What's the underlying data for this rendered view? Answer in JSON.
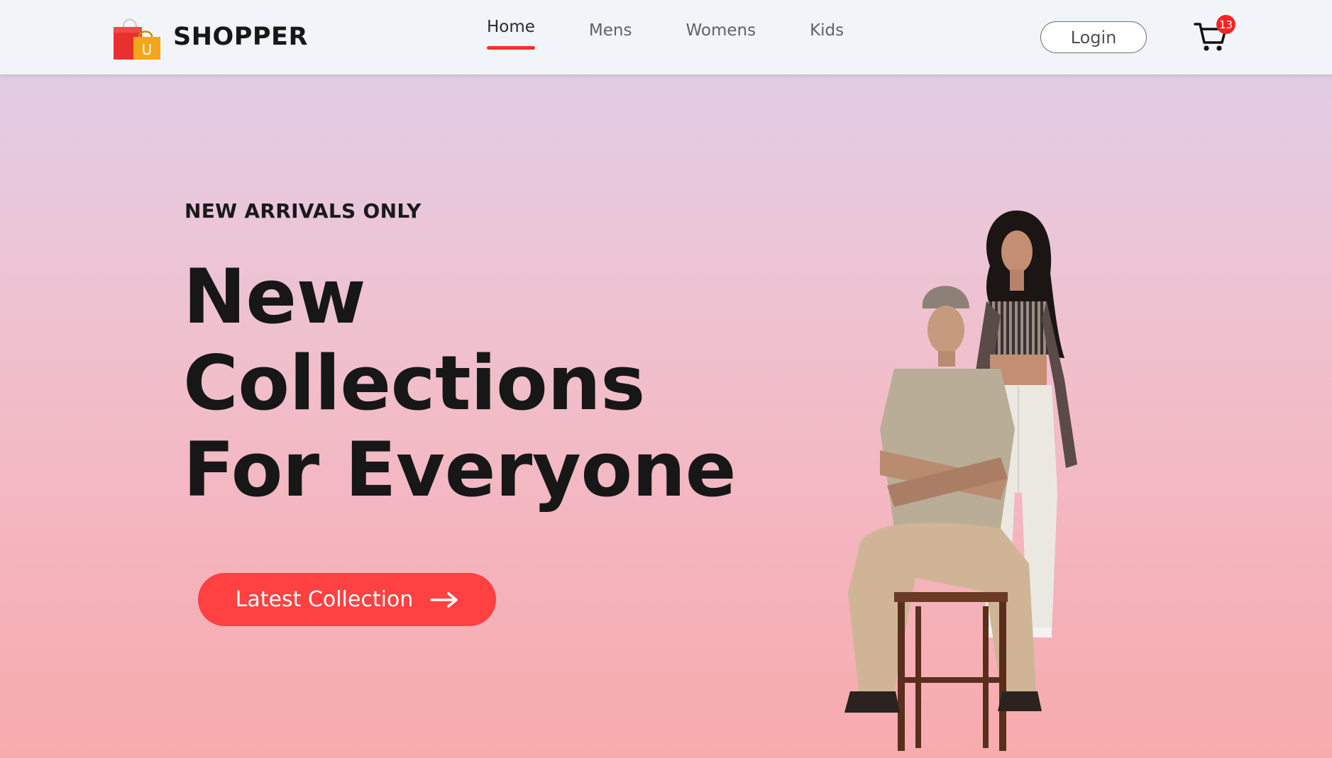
{
  "brand": {
    "name": "SHOPPER",
    "logo_letter": "U",
    "logo_icon": "shopping-bags-icon"
  },
  "nav": {
    "items": [
      {
        "label": "Home",
        "active": true
      },
      {
        "label": "Mens",
        "active": false
      },
      {
        "label": "Womens",
        "active": false
      },
      {
        "label": "Kids",
        "active": false
      }
    ],
    "login_label": "Login",
    "cart_icon": "shopping-cart-icon",
    "cart_count": "13"
  },
  "hero": {
    "kicker": "NEW ARRIVALS ONLY",
    "title_lines": [
      "New",
      "Collections",
      "For Everyone"
    ],
    "cta_label": "Latest Collection",
    "cta_icon": "arrow-right-icon",
    "image": "hero-models-illustration"
  },
  "colors": {
    "accent": "#ff4141",
    "underline": "#ff2d2d",
    "badge": "#ff2222",
    "nav_bg": "#f1f4f8"
  }
}
